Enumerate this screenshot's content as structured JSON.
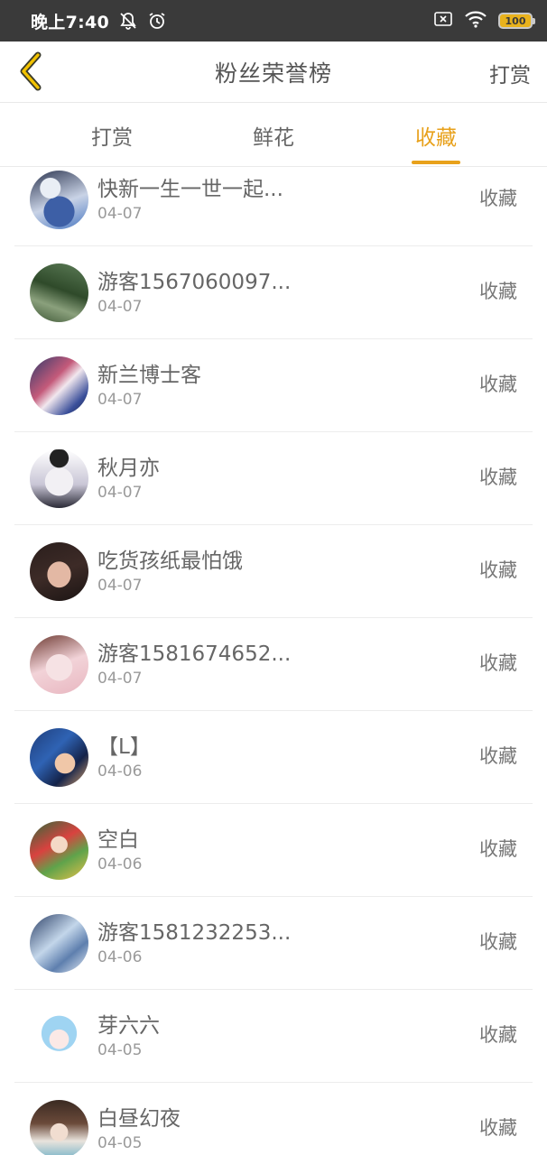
{
  "status_bar": {
    "time": "晚上7:40",
    "icons": [
      "bell-off-icon",
      "alarm-icon",
      "sim-x-icon",
      "wifi-icon"
    ],
    "battery": "100"
  },
  "nav": {
    "back_icon": "chevron-left-icon",
    "title": "粉丝荣誉榜",
    "action_label": "打赏",
    "accent_color": "#e8a11b"
  },
  "tabs": [
    {
      "label": "打赏",
      "active": false
    },
    {
      "label": "鲜花",
      "active": false
    },
    {
      "label": "收藏",
      "active": true
    }
  ],
  "list": [
    {
      "name": "快新一生一世一起...",
      "date": "04-07",
      "type": "收藏"
    },
    {
      "name": "游客1567060097...",
      "date": "04-07",
      "type": "收藏"
    },
    {
      "name": "新兰博士客",
      "date": "04-07",
      "type": "收藏"
    },
    {
      "name": "秋月亦",
      "date": "04-07",
      "type": "收藏"
    },
    {
      "name": "吃货孩纸最怕饿",
      "date": "04-07",
      "type": "收藏"
    },
    {
      "name": "游客1581674652...",
      "date": "04-07",
      "type": "收藏"
    },
    {
      "name": "【L】",
      "date": "04-06",
      "type": "收藏"
    },
    {
      "name": "空白",
      "date": "04-06",
      "type": "收藏"
    },
    {
      "name": "游客1581232253...",
      "date": "04-06",
      "type": "收藏"
    },
    {
      "name": "芽六六",
      "date": "04-05",
      "type": "收藏"
    },
    {
      "name": "白昼幻夜",
      "date": "04-05",
      "type": "收藏"
    }
  ]
}
